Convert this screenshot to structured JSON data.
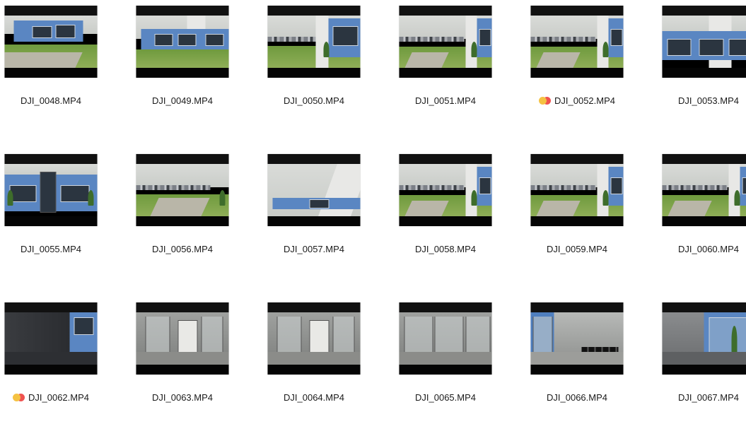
{
  "files": [
    {
      "name": "DJI_0048.MP4",
      "tags": [],
      "scene": "building-lawn"
    },
    {
      "name": "DJI_0049.MP4",
      "tags": [],
      "scene": "building-front"
    },
    {
      "name": "DJI_0050.MP4",
      "tags": [],
      "scene": "building-corner-lot"
    },
    {
      "name": "DJI_0051.MP4",
      "tags": [],
      "scene": "parking-lot-building"
    },
    {
      "name": "DJI_0052.MP4",
      "tags": [
        "#f5c242",
        "#ef5350"
      ],
      "scene": "parking-lot-building"
    },
    {
      "name": "DJI_0053.MP4",
      "tags": [],
      "scene": "building-front-close"
    },
    {
      "name": "DJI_0055.MP4",
      "tags": [],
      "scene": "building-entrance"
    },
    {
      "name": "DJI_0056.MP4",
      "tags": [],
      "scene": "parking-lot-path"
    },
    {
      "name": "DJI_0057.MP4",
      "tags": [],
      "scene": "building-sky"
    },
    {
      "name": "DJI_0058.MP4",
      "tags": [],
      "scene": "parking-lot-building"
    },
    {
      "name": "DJI_0059.MP4",
      "tags": [],
      "scene": "parking-lot-building"
    },
    {
      "name": "DJI_0060.MP4",
      "tags": [],
      "scene": "parking-lot-building"
    },
    {
      "name": "DJI_0062.MP4",
      "tags": [
        "#f5c242",
        "#ef5350"
      ],
      "scene": "dark-entrance"
    },
    {
      "name": "DJI_0063.MP4",
      "tags": [],
      "scene": "interior-hall"
    },
    {
      "name": "DJI_0064.MP4",
      "tags": [],
      "scene": "interior-hall"
    },
    {
      "name": "DJI_0065.MP4",
      "tags": [],
      "scene": "interior-glass"
    },
    {
      "name": "DJI_0066.MP4",
      "tags": [],
      "scene": "interior-chairs"
    },
    {
      "name": "DJI_0067.MP4",
      "tags": [],
      "scene": "interior-window"
    }
  ],
  "colors": {
    "label_text": "#1a1a1a",
    "tag_yellow": "#f5c242",
    "tag_red": "#ef5350"
  },
  "icons": {
    "video_thumbnail": "video-thumbnail-icon",
    "tag_indicator": "color-tag-icon"
  }
}
